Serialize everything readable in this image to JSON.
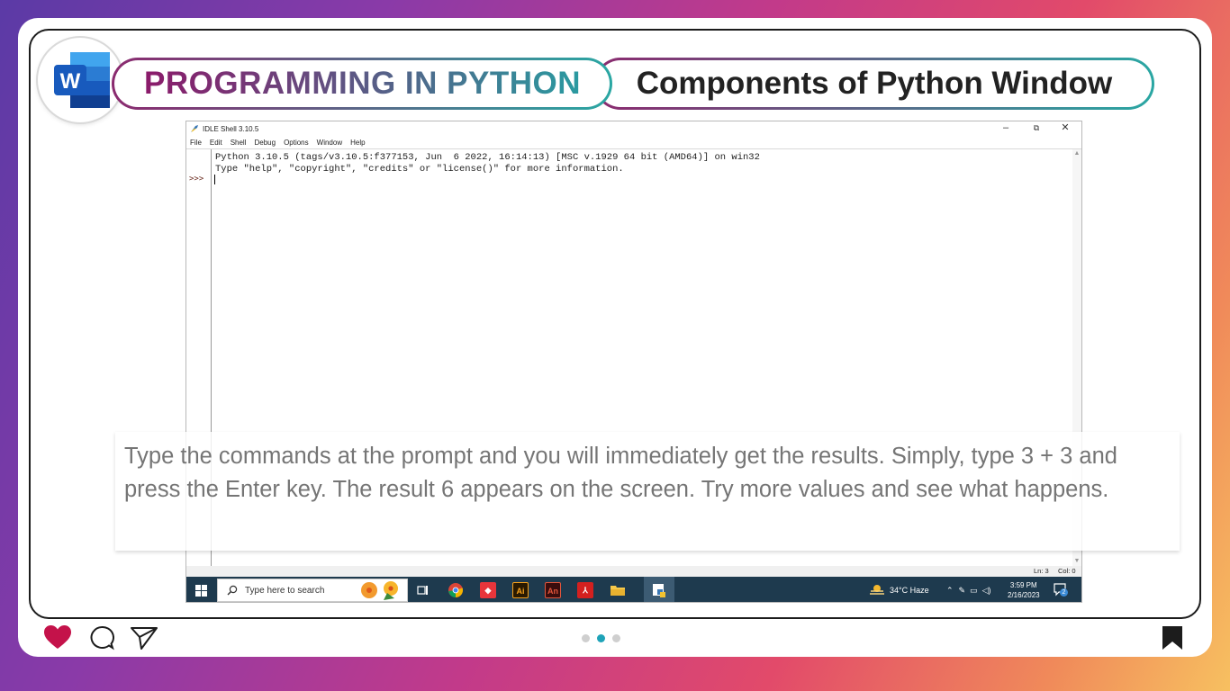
{
  "header": {
    "logo_icon": "word-logo-icon",
    "logo_letter": "W",
    "title_left": "PROGRAMMING IN PYTHON",
    "title_right": "Components of Python Window"
  },
  "idle": {
    "window_title": "IDLE Shell 3.10.5",
    "window_controls": {
      "minimize": "–",
      "restore": "⧉",
      "close": "✕"
    },
    "menu": [
      "File",
      "Edit",
      "Shell",
      "Debug",
      "Options",
      "Window",
      "Help"
    ],
    "output_lines": [
      "Python 3.10.5 (tags/v3.10.5:f377153, Jun  6 2022, 16:14:13) [MSC v.1929 64 bit (AMD64)] on win32",
      "Type \"help\", \"copyright\", \"credits\" or \"license()\" for more information."
    ],
    "prompt": ">>>",
    "status": {
      "line": "Ln: 3",
      "col": "Col: 0"
    }
  },
  "taskbar": {
    "search_placeholder": "Type here to search",
    "weather": "34°C  Haze",
    "time": "3:59 PM",
    "date": "2/16/2023",
    "notification_count": "2",
    "apps": [
      {
        "icon": "task-view-icon",
        "label": ""
      },
      {
        "icon": "chrome-icon",
        "label": ""
      },
      {
        "icon": "anydesk-icon",
        "label": ""
      },
      {
        "icon": "illustrator-icon",
        "label": "Ai"
      },
      {
        "icon": "animate-icon",
        "label": "An"
      },
      {
        "icon": "acrobat-icon",
        "label": ""
      },
      {
        "icon": "file-explorer-icon",
        "label": ""
      },
      {
        "icon": "idle-python-icon",
        "label": ""
      }
    ]
  },
  "caption": "Type the commands at the prompt and you will immediately get the results. Simply, type 3 + 3 and press the Enter key. The result 6 appears on the screen. Try more values and see what happens.",
  "footer": {
    "icons": [
      "heart-icon",
      "comment-icon",
      "send-icon",
      "bookmark-icon"
    ],
    "carousel_dots": 3,
    "active_dot": 2
  },
  "colors": {
    "accent_teal": "#1fa3b8",
    "title_purple": "#8b1a6a",
    "heart": "#c4124a"
  }
}
